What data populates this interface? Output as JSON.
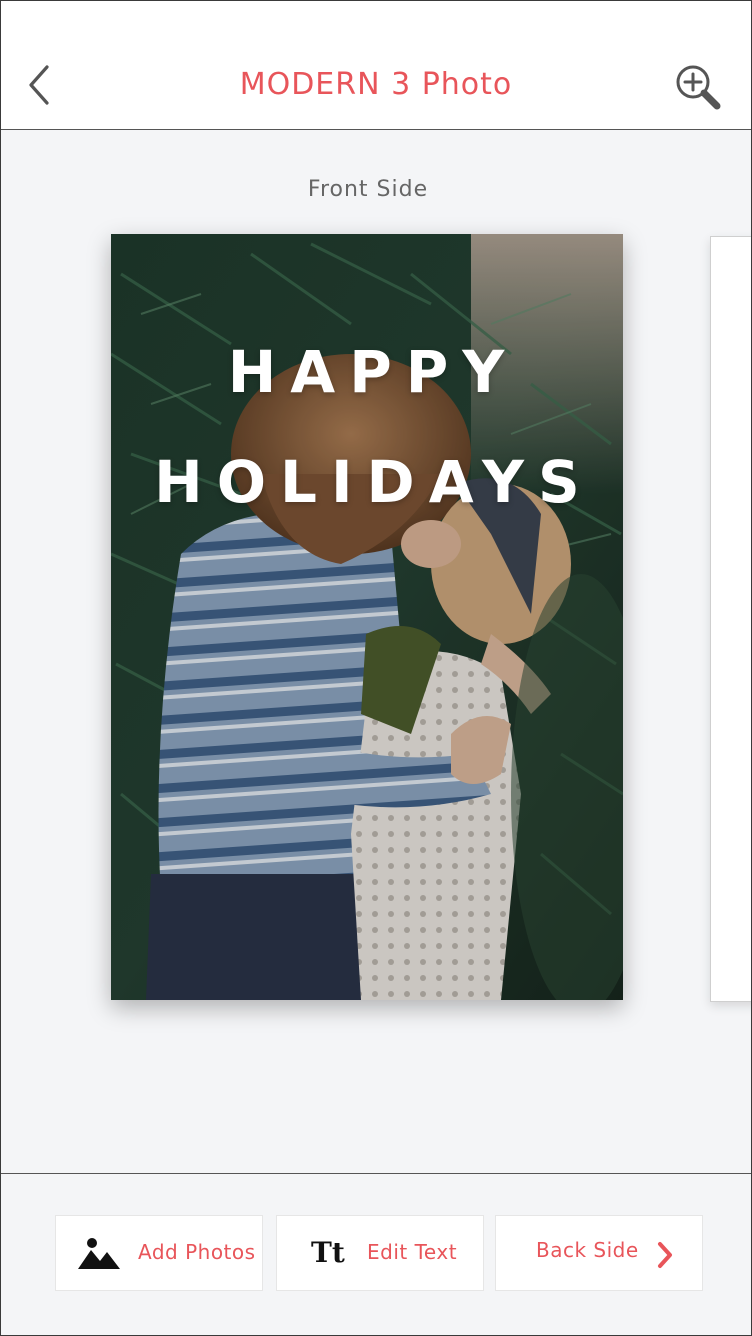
{
  "header": {
    "title": "MODERN 3 Photo",
    "back_icon": "chevron-left-icon",
    "zoom_icon": "zoom-in-icon"
  },
  "canvas": {
    "side_label": "Front Side",
    "card": {
      "greeting_line1": "HAPPY",
      "greeting_line2": "HOLIDAYS"
    }
  },
  "toolbar": {
    "add_photos_label": "Add Photos",
    "add_photos_icon": "image-mountains-icon",
    "edit_text_label": "Edit Text",
    "edit_text_icon_glyph": "Tt",
    "back_side_label": "Back Side",
    "back_side_icon": "chevron-right-icon"
  },
  "colors": {
    "accent": "#e8555a",
    "background": "#f4f5f7",
    "surface": "#ffffff",
    "muted_text": "#666666"
  }
}
